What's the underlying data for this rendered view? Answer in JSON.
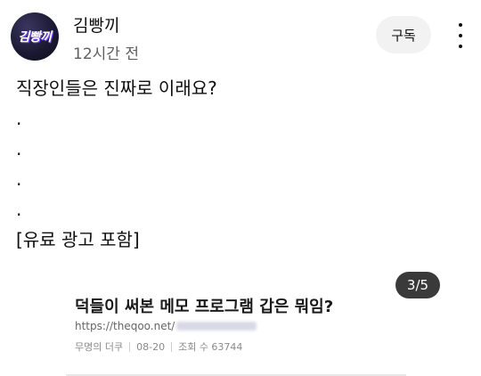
{
  "channel": {
    "avatar_text": "김빵끼",
    "name": "김빵끼",
    "time": "12시간 전",
    "subscribe_label": "구독",
    "more_icon": "vertical-dots-icon"
  },
  "post": {
    "lines": [
      "직장인들은 진짜로 이래요?",
      ".",
      ".",
      ".",
      ".",
      "[유료 광고 포함]"
    ]
  },
  "card": {
    "title": "덕들이 써본 메모 프로그램 갑은 뭐임?",
    "url": "https://theqoo.net/",
    "author": "무명의 더쿠",
    "date": "08-20",
    "views": "조회 수 63744"
  },
  "carousel": {
    "indicator": "3/5",
    "current": 3,
    "total": 5
  },
  "colors": {
    "avatar_bg": "#1c1a33",
    "subscribe_bg": "#f2f2f2",
    "indicator_bg": "#3a3a3a"
  }
}
